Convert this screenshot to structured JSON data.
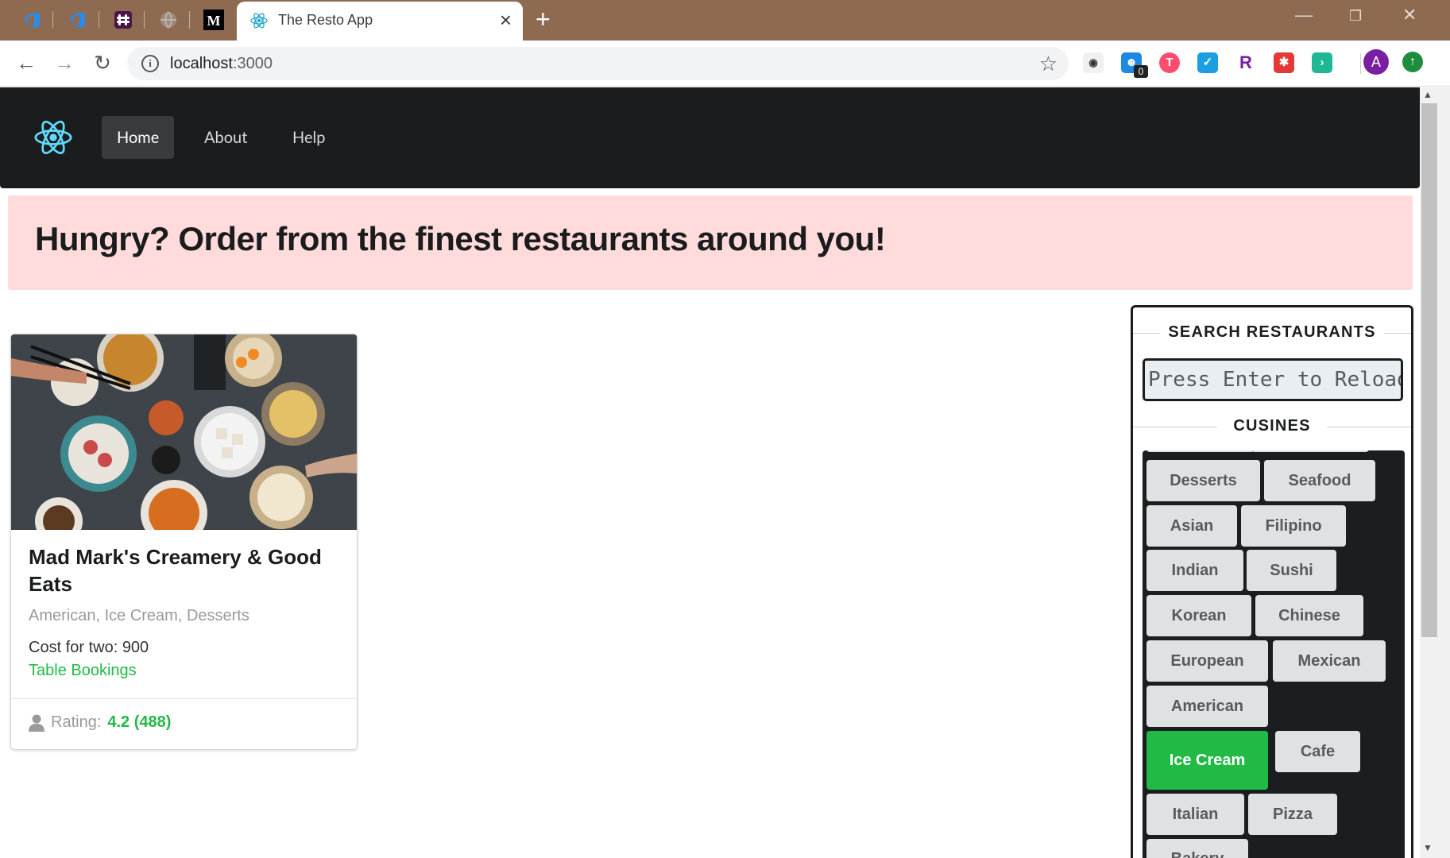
{
  "browser": {
    "tab_title": "The Resto App",
    "url_host": "localhost",
    "url_port": ":3000",
    "extension_badge": "0",
    "profile_initial": "A"
  },
  "nav": {
    "items": [
      {
        "label": "Home",
        "active": true
      },
      {
        "label": "About",
        "active": false
      },
      {
        "label": "Help",
        "active": false
      }
    ]
  },
  "hero": {
    "headline": "Hungry? Order from the finest restaurants around you!"
  },
  "restaurant": {
    "name": "Mad Mark's Creamery & Good Eats",
    "cuisines": "American, Ice Cream, Desserts",
    "cost": "Cost for two: 900",
    "booking": "Table Bookings",
    "rating_label": "Rating:",
    "rating_value": "4.2 (488)"
  },
  "sidebar": {
    "search_header": "SEARCH RESTAURANTS",
    "search_placeholder": "Press Enter to Reload",
    "cuisines_header": "CUSINES",
    "cuisines": [
      {
        "label": "Desserts",
        "selected": false
      },
      {
        "label": "Seafood",
        "selected": false
      },
      {
        "label": "Asian",
        "selected": false
      },
      {
        "label": "Filipino",
        "selected": false
      },
      {
        "label": "Indian",
        "selected": false
      },
      {
        "label": "Sushi",
        "selected": false
      },
      {
        "label": "Korean",
        "selected": false
      },
      {
        "label": "Chinese",
        "selected": false
      },
      {
        "label": "European",
        "selected": false
      },
      {
        "label": "Mexican",
        "selected": false
      },
      {
        "label": "American",
        "selected": false
      },
      {
        "label": "Ice Cream",
        "selected": true
      },
      {
        "label": "Cafe",
        "selected": false
      },
      {
        "label": "Italian",
        "selected": false
      },
      {
        "label": "Pizza",
        "selected": false
      },
      {
        "label": "Bakery",
        "selected": false
      }
    ]
  },
  "colors": {
    "navbar": "#1b1c1d",
    "hero_bg": "#ffdbdc",
    "accent_green": "#21ba45",
    "tabbar": "#8e6a50"
  }
}
